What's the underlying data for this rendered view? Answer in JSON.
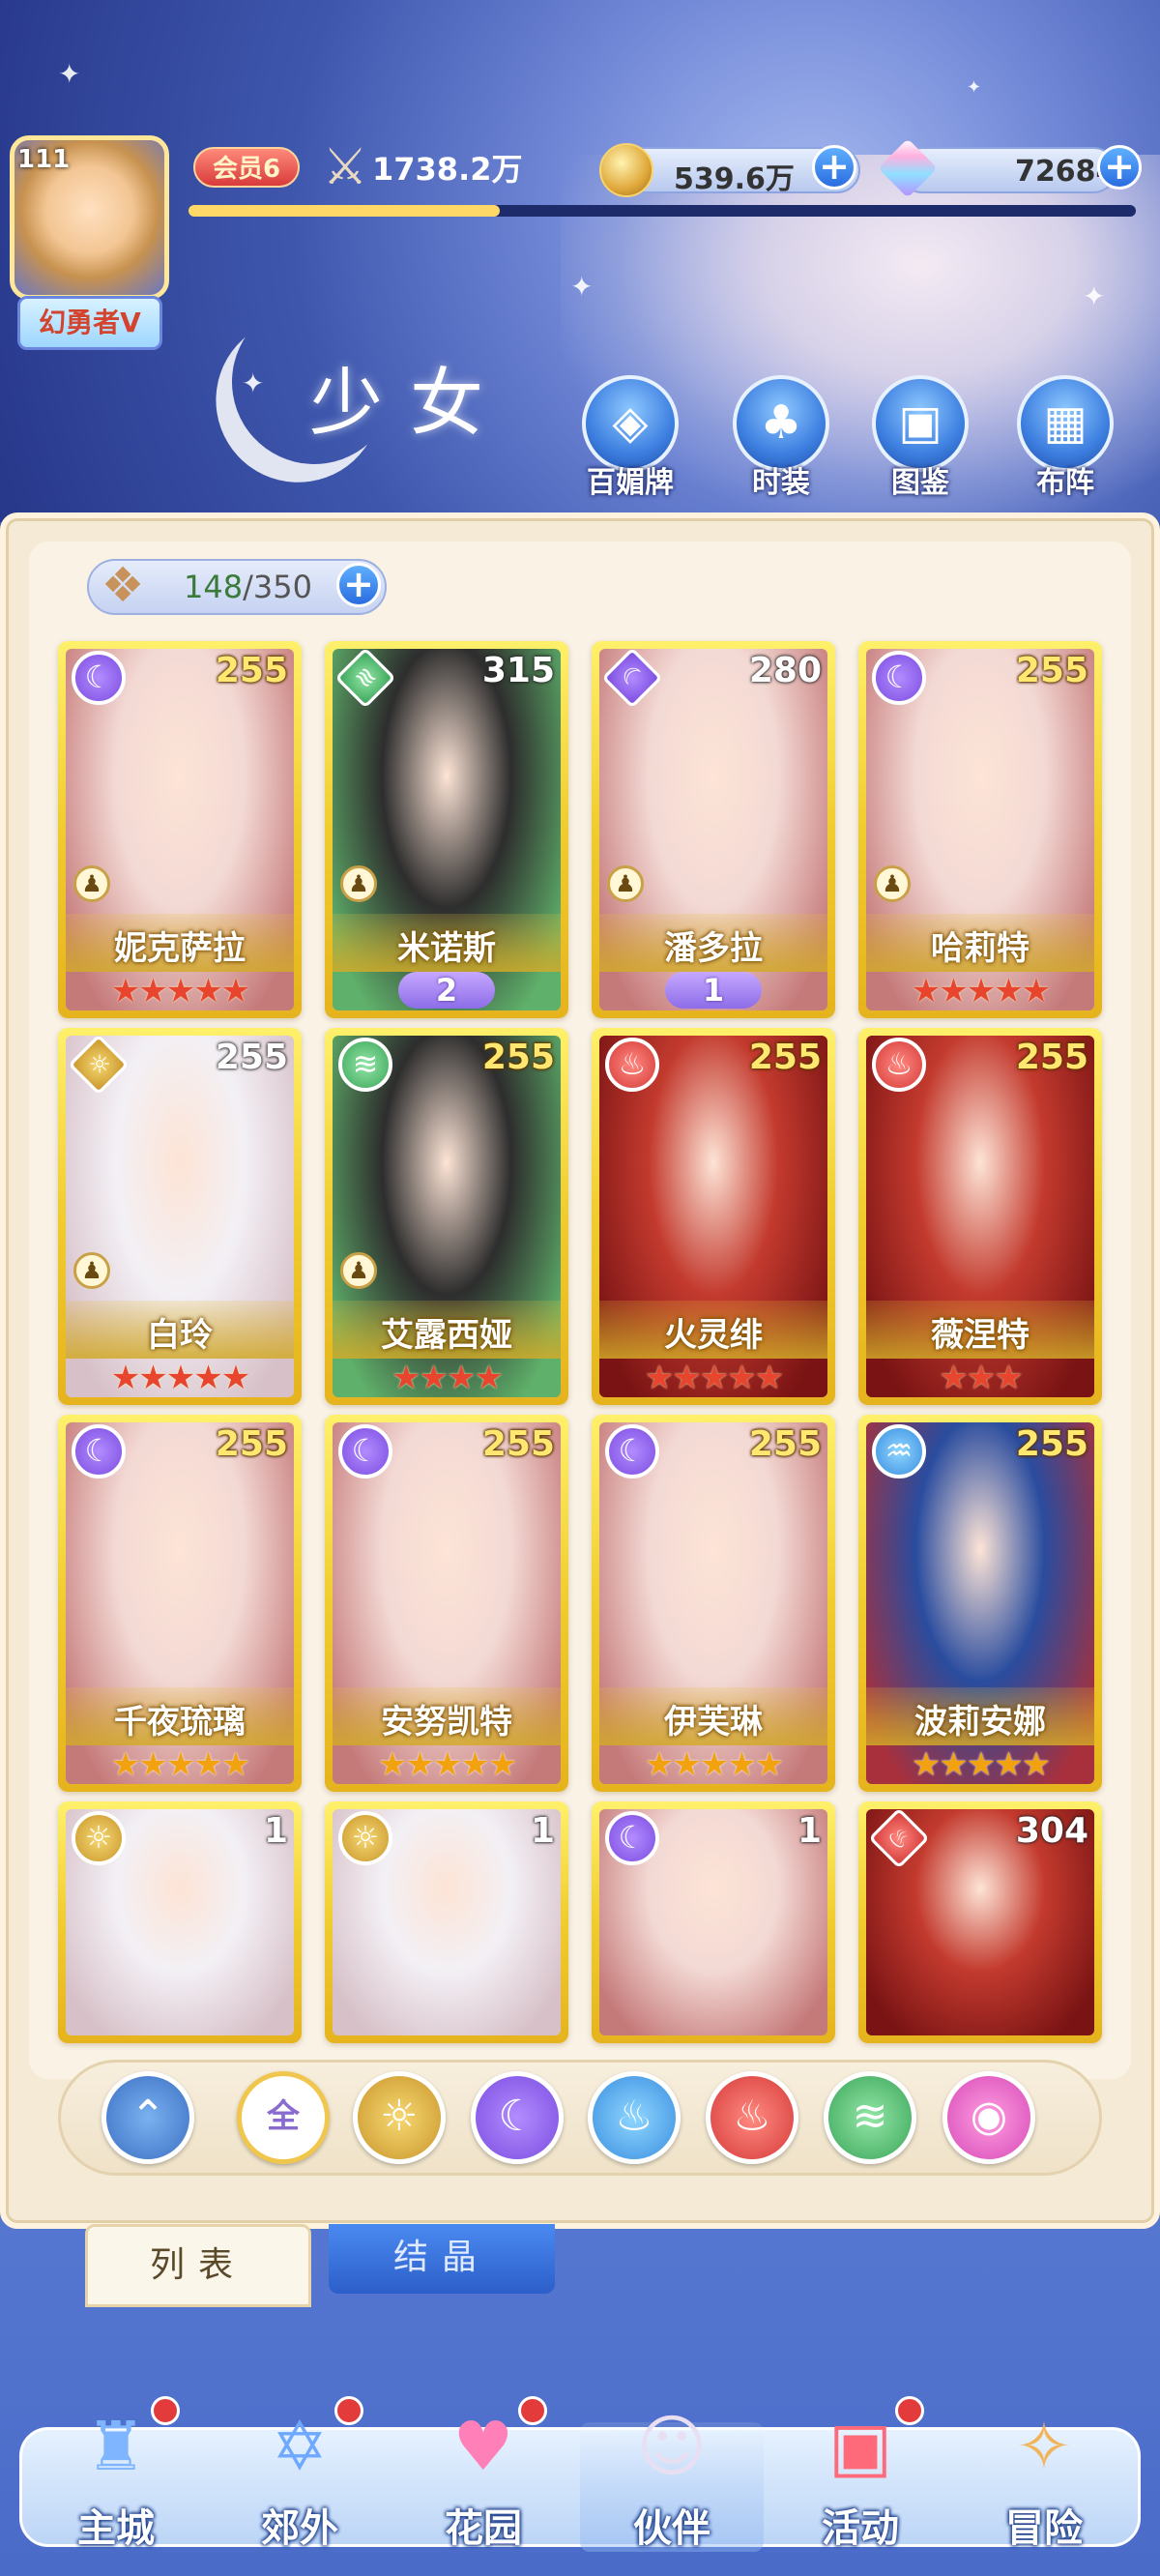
{
  "player": {
    "level": "111",
    "name": "幻勇者V",
    "vip": "会员6",
    "power": "1738.2万"
  },
  "currency": {
    "gold": "539.6万",
    "diamond": "72684"
  },
  "page_title": "少女",
  "features": [
    "百媚牌",
    "时装",
    "图鉴",
    "布阵"
  ],
  "roster": {
    "count": "148",
    "capacity": "/350"
  },
  "cards": [
    {
      "name": "妮克萨拉",
      "level": "255",
      "element": "moon",
      "stars": 5,
      "star_color": "red",
      "awaken": ""
    },
    {
      "name": "米诺斯",
      "level": "315",
      "element": "wind",
      "stars": 0,
      "star_color": "red",
      "awaken": "2"
    },
    {
      "name": "潘多拉",
      "level": "280",
      "element": "moon",
      "stars": 0,
      "star_color": "red",
      "awaken": "1"
    },
    {
      "name": "哈莉特",
      "level": "255",
      "element": "moon",
      "stars": 5,
      "star_color": "red",
      "awaken": ""
    },
    {
      "name": "白玲",
      "level": "255",
      "element": "sun",
      "stars": 5,
      "star_color": "red",
      "awaken": ""
    },
    {
      "name": "艾露西娅",
      "level": "255",
      "element": "wind",
      "stars": 4,
      "star_color": "red",
      "awaken": ""
    },
    {
      "name": "火灵绯",
      "level": "255",
      "element": "fire",
      "stars": 5,
      "star_color": "red",
      "awaken": ""
    },
    {
      "name": "薇涅特",
      "level": "255",
      "element": "fire",
      "stars": 3,
      "star_color": "red",
      "awaken": ""
    },
    {
      "name": "千夜琉璃",
      "level": "255",
      "element": "moon",
      "stars": 5,
      "star_color": "gold",
      "awaken": ""
    },
    {
      "name": "安努凯特",
      "level": "255",
      "element": "moon",
      "stars": 5,
      "star_color": "gold",
      "awaken": ""
    },
    {
      "name": "伊芙琳",
      "level": "255",
      "element": "moon",
      "stars": 5,
      "star_color": "gold",
      "awaken": ""
    },
    {
      "name": "波莉安娜",
      "level": "255",
      "element": "water",
      "stars": 5,
      "star_color": "gold",
      "awaken": ""
    },
    {
      "name": "",
      "level": "1",
      "element": "sun",
      "stars": 0,
      "star_color": "gold",
      "awaken": ""
    },
    {
      "name": "",
      "level": "1",
      "element": "sun",
      "stars": 0,
      "star_color": "gold",
      "awaken": ""
    },
    {
      "name": "",
      "level": "1",
      "element": "moon",
      "stars": 0,
      "star_color": "gold",
      "awaken": ""
    },
    {
      "name": "",
      "level": "304",
      "element": "fire",
      "stars": 0,
      "star_color": "gold",
      "awaken": ""
    }
  ],
  "filters": {
    "all_label": "全"
  },
  "tabs": {
    "list": "列表",
    "crystal": "结晶"
  },
  "nav": [
    "主城",
    "郊外",
    "花园",
    "伙伴",
    "活动",
    "冒险"
  ]
}
